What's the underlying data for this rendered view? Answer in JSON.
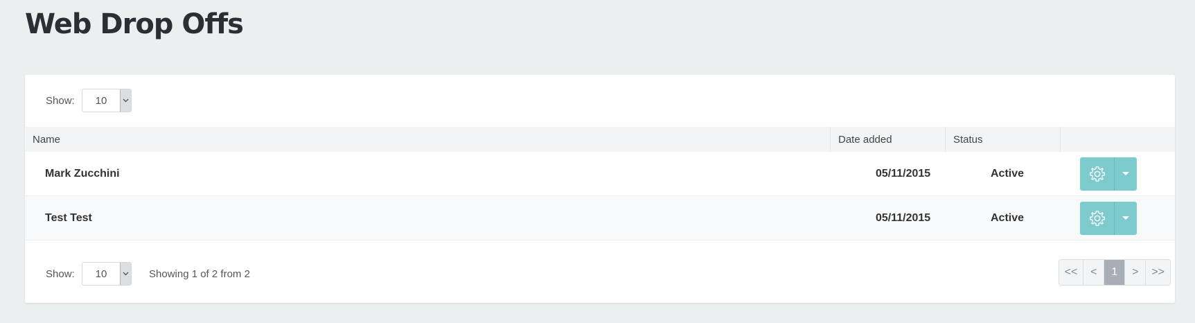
{
  "page": {
    "title": "Web Drop Offs"
  },
  "top_controls": {
    "show_label": "Show:",
    "page_size": "10"
  },
  "table": {
    "columns": [
      "Name",
      "Date added",
      "Status",
      ""
    ],
    "rows": [
      {
        "name": "Mark Zucchini",
        "date_added": "05/11/2015",
        "status": "Active"
      },
      {
        "name": "Test Test",
        "date_added": "05/11/2015",
        "status": "Active"
      }
    ]
  },
  "bottom_controls": {
    "show_label": "Show:",
    "page_size": "10",
    "showing_text": "Showing 1 of 2 from 2"
  },
  "pagination": {
    "first": "<<",
    "prev": "<",
    "current": "1",
    "next": ">",
    "last": ">>"
  },
  "colors": {
    "accent": "#7ecbcd",
    "page_bg": "#ecefef",
    "active_page": "#a9aeb6"
  },
  "icons": {
    "row_action": "gear-icon",
    "row_menu": "caret-down-icon"
  }
}
